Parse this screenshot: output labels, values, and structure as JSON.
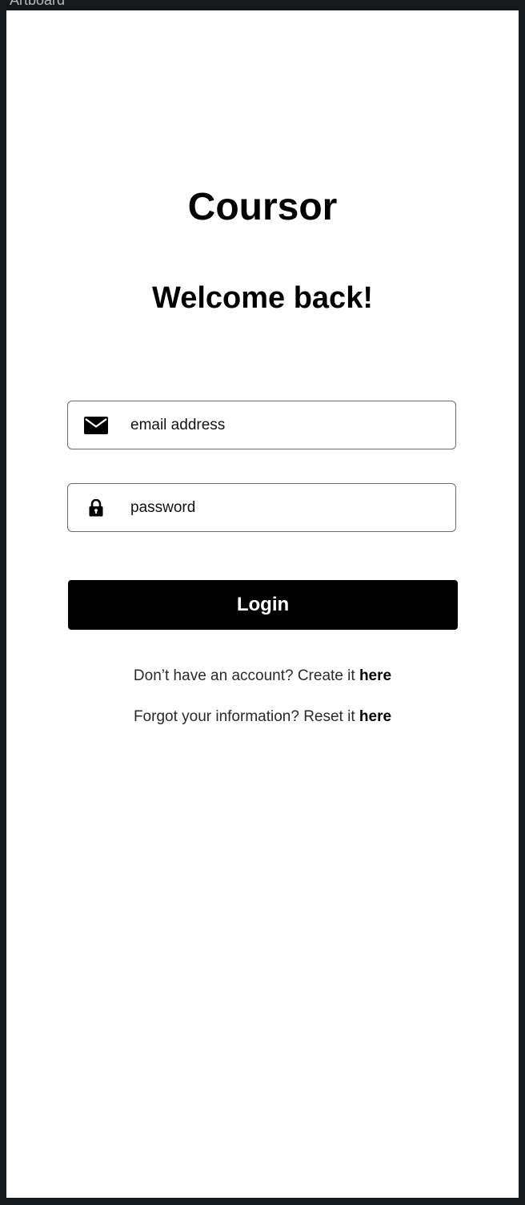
{
  "artboard_label": "Artboard",
  "app": {
    "title": "Coursor",
    "welcome": "Welcome back!"
  },
  "form": {
    "email": {
      "icon": "envelope-icon",
      "placeholder": "email address",
      "value": ""
    },
    "password": {
      "icon": "lock-icon",
      "placeholder": "password",
      "value": ""
    },
    "login_label": "Login"
  },
  "footer": {
    "create_text": "Don’t have an account? Create it ",
    "create_link": "here",
    "reset_text": "Forgot your information? Reset it ",
    "reset_link": "here"
  },
  "colors": {
    "background": "#16191b",
    "surface": "#ffffff",
    "primary": "#000000",
    "field_border": "#6d6d6d"
  }
}
